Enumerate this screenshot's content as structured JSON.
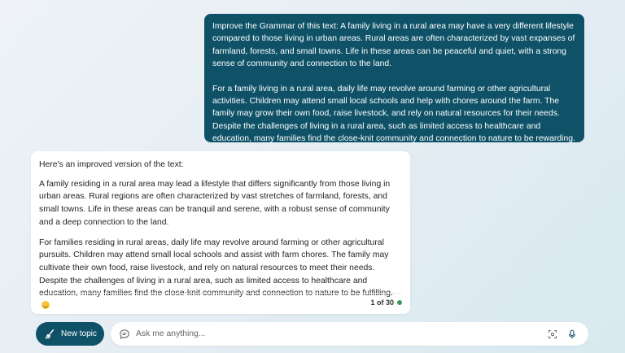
{
  "user_message": {
    "paragraphs": [
      "Improve the Grammar of this text: A family living in a rural area may have a very different lifestyle compared to those living in urban areas. Rural areas are often characterized by vast expanses of farmland, forests, and small towns. Life in these areas can be peaceful and quiet, with a strong sense of community and connection to the land.",
      "For a family living in a rural area, daily life may revolve around farming or other agricultural activities. Children may attend small local schools and help with chores around the farm. The family may grow their own food, raise livestock, and rely on natural resources for their needs. Despite the challenges of living in a rural area, such as limited access to healthcare and education, many families find the close-knit community and connection to nature to be rewarding."
    ]
  },
  "bot_message": {
    "intro": "Here's an improved version of the text:",
    "paragraphs": [
      "A family residing in a rural area may lead a lifestyle that differs significantly from those living in urban areas. Rural regions are often characterized by vast stretches of farmland, forests, and small towns. Life in these areas can be tranquil and serene, with a robust sense of community and a deep connection to the land.",
      "For families residing in rural areas, daily life may revolve around farming or other agricultural pursuits. Children may attend small local schools and assist with farm chores. The family may cultivate their own food, raise livestock, and rely on natural resources to meet their needs. Despite the challenges of living in a rural area, such as limited access to healthcare and education, many families find the close-knit community and connection to nature to be fulfilling."
    ],
    "emoji": "smiling-face",
    "counter": "1 of 30",
    "status_color": "#3c9a5f"
  },
  "composer": {
    "new_topic_label": "New topic",
    "placeholder": "Ask me anything...",
    "icons": [
      "broom-icon",
      "chat-icon",
      "screenshot-icon",
      "microphone-icon"
    ]
  },
  "colors": {
    "accent": "#0f5268",
    "user_text": "#ffffff"
  }
}
